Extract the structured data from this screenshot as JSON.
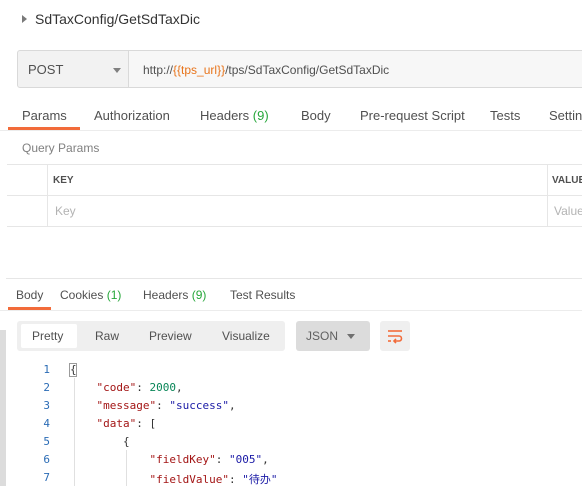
{
  "request": {
    "title": "SdTaxConfig/GetSdTaxDic",
    "method": "POST",
    "url_prefix": "http://",
    "url_var": "{{tps_url}}",
    "url_suffix": "/tps/SdTaxConfig/GetSdTaxDic"
  },
  "request_tabs": {
    "params": "Params",
    "authorization": "Authorization",
    "headers": "Headers",
    "headers_count": "(9)",
    "body": "Body",
    "prerequest": "Pre-request Script",
    "tests": "Tests",
    "settings": "Settin"
  },
  "query_params": {
    "label": "Query Params",
    "col_key": "KEY",
    "col_value": "VALUE",
    "key_placeholder": "Key",
    "value_placeholder": "Value"
  },
  "response_tabs": {
    "body": "Body",
    "cookies": "Cookies",
    "cookies_count": "(1)",
    "headers": "Headers",
    "headers_count": "(9)",
    "test_results": "Test Results"
  },
  "view_modes": [
    "Pretty",
    "Raw",
    "Preview",
    "Visualize"
  ],
  "format": "JSON",
  "icons": {
    "wrap": "wrap-lines-icon",
    "expand": "caret-right-icon",
    "dropdown": "chevron-down-icon"
  },
  "colors": {
    "accent": "#f26b3a",
    "count": "#26a73a",
    "url_var": "#e8741b"
  },
  "code_lines": [
    {
      "n": "1",
      "indent": "",
      "parts": [
        [
          "p",
          "{"
        ]
      ]
    },
    {
      "n": "2",
      "indent": "    ",
      "parts": [
        [
          "k",
          "\"code\""
        ],
        [
          "p",
          ": "
        ],
        [
          "n",
          "2000"
        ],
        [
          "p",
          ","
        ]
      ]
    },
    {
      "n": "3",
      "indent": "    ",
      "parts": [
        [
          "k",
          "\"message\""
        ],
        [
          "p",
          ": "
        ],
        [
          "s",
          "\"success\""
        ],
        [
          "p",
          ","
        ]
      ]
    },
    {
      "n": "4",
      "indent": "    ",
      "parts": [
        [
          "k",
          "\"data\""
        ],
        [
          "p",
          ": ["
        ]
      ]
    },
    {
      "n": "5",
      "indent": "        ",
      "parts": [
        [
          "p",
          "{"
        ]
      ]
    },
    {
      "n": "6",
      "indent": "            ",
      "parts": [
        [
          "k",
          "\"fieldKey\""
        ],
        [
          "p",
          ": "
        ],
        [
          "s",
          "\"005\""
        ],
        [
          "p",
          ","
        ]
      ]
    },
    {
      "n": "7",
      "indent": "            ",
      "parts": [
        [
          "k",
          "\"fieldValue\""
        ],
        [
          "p",
          ": "
        ],
        [
          "s",
          "\"待办\""
        ]
      ]
    }
  ]
}
